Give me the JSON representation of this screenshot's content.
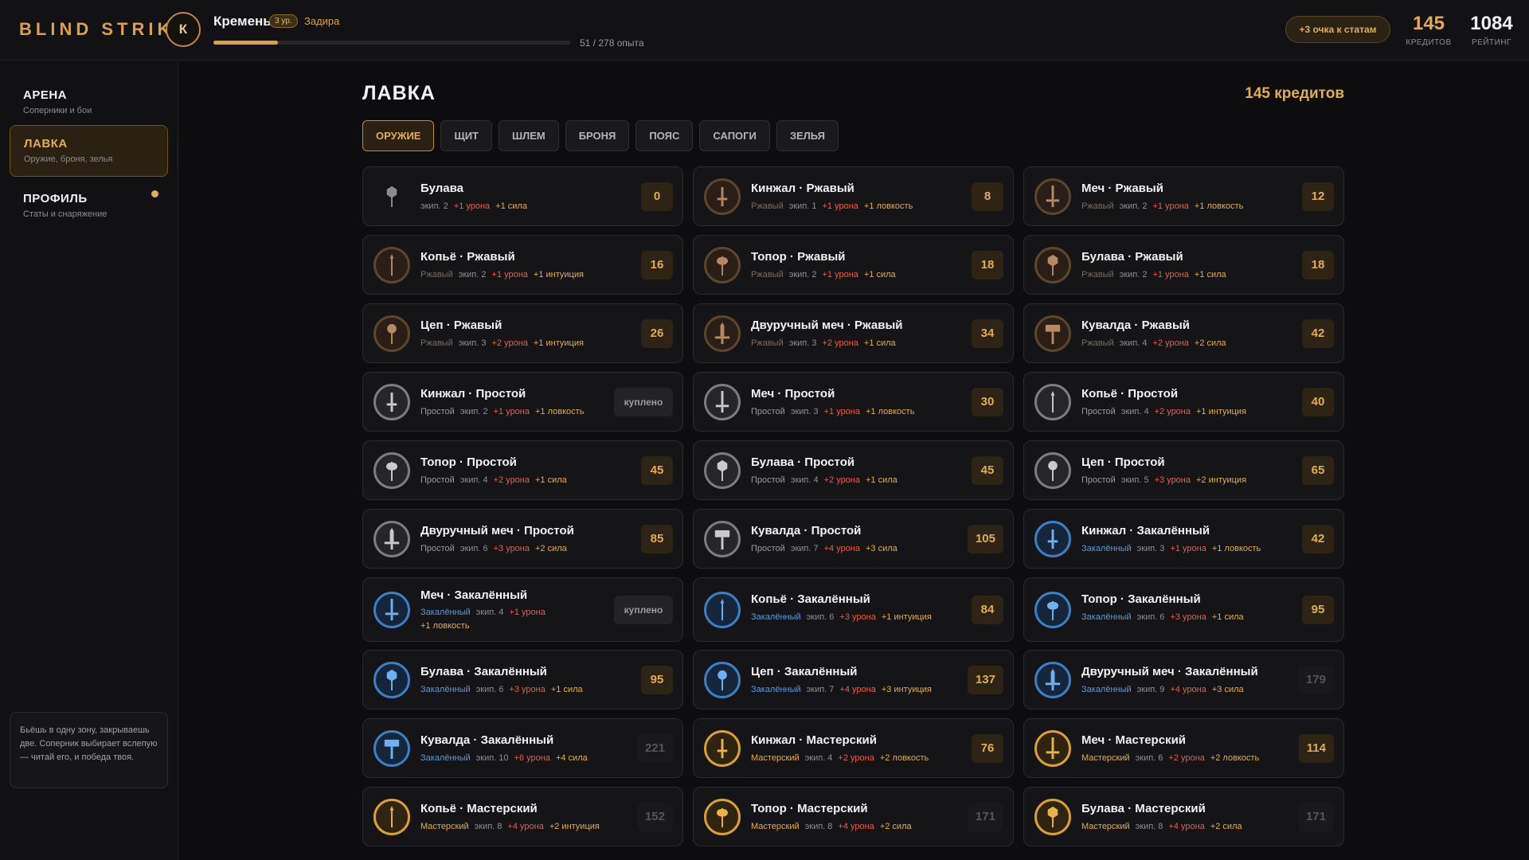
{
  "app": {
    "logo": "BLIND STRIKE",
    "user": {
      "initial": "К",
      "name": "Кремень",
      "level": "3 ур.",
      "class": "Задира",
      "xp_text": "51 / 278 опыта",
      "xp_progress": 0.18
    },
    "stat_points_button": "+3 очка к статам",
    "credits": {
      "value": "145",
      "label": "КРЕДИТОВ"
    },
    "rating": {
      "value": "1084",
      "label": "РЕЙТИНГ"
    }
  },
  "sidebar": {
    "items": [
      {
        "title": "АРЕНА",
        "sub": "Соперники и бои"
      },
      {
        "title": "ЛАВКА",
        "sub": "Оружие, броня, зелья"
      },
      {
        "title": "ПРОФИЛЬ",
        "sub": "Статы и снаряжение"
      }
    ],
    "tip": "Бьёшь в одну зону, закрываешь две. Соперник выбирает вслепую — читай его, и победа твоя."
  },
  "shop": {
    "title": "ЛАВКА",
    "credits": "145 кредитов",
    "tabs": [
      "ОРУЖИЕ",
      "ЩИТ",
      "ШЛЕМ",
      "БРОНЯ",
      "ПОЯС",
      "САПОГИ",
      "ЗЕЛЬЯ"
    ],
    "active_tab": 0,
    "items": [
      {
        "name": "Булава",
        "tier": "",
        "tier_class": "none",
        "icon": "mace-icon",
        "req": "экип. 2",
        "stat1": "+1 урона",
        "stat2": "+1 сила",
        "price": "0",
        "state": "buy"
      },
      {
        "name": "Кинжал · Ржавый",
        "tier": "Ржавый",
        "tier_class": "rust",
        "icon": "dagger-icon",
        "req": "экип. 1",
        "stat1": "+1 урона",
        "stat2": "+1 ловкость",
        "price": "8",
        "state": "buy"
      },
      {
        "name": "Меч · Ржавый",
        "tier": "Ржавый",
        "tier_class": "rust",
        "icon": "sword-icon",
        "req": "экип. 2",
        "stat1": "+1 урона",
        "stat2": "+1 ловкость",
        "price": "12",
        "state": "buy"
      },
      {
        "name": "Копьё · Ржавый",
        "tier": "Ржавый",
        "tier_class": "rust",
        "icon": "spear-icon",
        "req": "экип. 2",
        "stat1": "+1 урона",
        "stat2": "+1 интуиция",
        "price": "16",
        "state": "buy"
      },
      {
        "name": "Топор · Ржавый",
        "tier": "Ржавый",
        "tier_class": "rust",
        "icon": "axe-icon",
        "req": "экип. 2",
        "stat1": "+1 урона",
        "stat2": "+1 сила",
        "price": "18",
        "state": "buy"
      },
      {
        "name": "Булава · Ржавый",
        "tier": "Ржавый",
        "tier_class": "rust",
        "icon": "mace-icon",
        "req": "экип. 2",
        "stat1": "+1 урона",
        "stat2": "+1 сила",
        "price": "18",
        "state": "buy"
      },
      {
        "name": "Цеп · Ржавый",
        "tier": "Ржавый",
        "tier_class": "rust",
        "icon": "flail-icon",
        "req": "экип. 3",
        "stat1": "+2 урона",
        "stat2": "+1 интуиция",
        "price": "26",
        "state": "buy"
      },
      {
        "name": "Двуручный меч · Ржавый",
        "tier": "Ржавый",
        "tier_class": "rust",
        "icon": "greatsword-icon",
        "req": "экип. 3",
        "stat1": "+2 урона",
        "stat2": "+1 сила",
        "price": "34",
        "state": "buy"
      },
      {
        "name": "Кувалда · Ржавый",
        "tier": "Ржавый",
        "tier_class": "rust",
        "icon": "hammer-icon",
        "req": "экип. 4",
        "stat1": "+2 урона",
        "stat2": "+2 сила",
        "price": "42",
        "state": "buy"
      },
      {
        "name": "Кинжал · Простой",
        "tier": "Простой",
        "tier_class": "simple",
        "icon": "dagger-icon",
        "req": "экип. 2",
        "stat1": "+1 урона",
        "stat2": "+1 ловкость",
        "price": "куплено",
        "state": "owned"
      },
      {
        "name": "Меч · Простой",
        "tier": "Простой",
        "tier_class": "simple",
        "icon": "sword-icon",
        "req": "экип. 3",
        "stat1": "+1 урона",
        "stat2": "+1 ловкость",
        "price": "30",
        "state": "buy"
      },
      {
        "name": "Копьё · Простой",
        "tier": "Простой",
        "tier_class": "simple",
        "icon": "spear-icon",
        "req": "экип. 4",
        "stat1": "+2 урона",
        "stat2": "+1 интуиция",
        "price": "40",
        "state": "buy"
      },
      {
        "name": "Топор · Простой",
        "tier": "Простой",
        "tier_class": "simple",
        "icon": "axe-icon",
        "req": "экип. 4",
        "stat1": "+2 урона",
        "stat2": "+1 сила",
        "price": "45",
        "state": "buy"
      },
      {
        "name": "Булава · Простой",
        "tier": "Простой",
        "tier_class": "simple",
        "icon": "mace-icon",
        "req": "экип. 4",
        "stat1": "+2 урона",
        "stat2": "+1 сила",
        "price": "45",
        "state": "buy"
      },
      {
        "name": "Цеп · Простой",
        "tier": "Простой",
        "tier_class": "simple",
        "icon": "flail-icon",
        "req": "экип. 5",
        "stat1": "+3 урона",
        "stat2": "+2 интуиция",
        "price": "65",
        "state": "buy"
      },
      {
        "name": "Двуручный меч · Простой",
        "tier": "Простой",
        "tier_class": "simple",
        "icon": "greatsword-icon",
        "req": "экип. 6",
        "stat1": "+3 урона",
        "stat2": "+2 сила",
        "price": "85",
        "state": "buy"
      },
      {
        "name": "Кувалда · Простой",
        "tier": "Простой",
        "tier_class": "simple",
        "icon": "hammer-icon",
        "req": "экип. 7",
        "stat1": "+4 урона",
        "stat2": "+3 сила",
        "price": "105",
        "state": "buy"
      },
      {
        "name": "Кинжал · Закалённый",
        "tier": "Закалённый",
        "tier_class": "temp",
        "icon": "dagger-icon",
        "req": "экип. 3",
        "stat1": "+1 урона",
        "stat2": "+1 ловкость",
        "price": "42",
        "state": "buy"
      },
      {
        "name": "Меч · Закалённый",
        "tier": "Закалённый",
        "tier_class": "temp",
        "icon": "sword-icon",
        "req": "экип. 4",
        "stat1": "+1 урона",
        "stat2": "+1 ловкость",
        "price": "куплено",
        "state": "owned"
      },
      {
        "name": "Копьё · Закалённый",
        "tier": "Закалённый",
        "tier_class": "temp",
        "icon": "spear-icon",
        "req": "экип. 6",
        "stat1": "+3 урона",
        "stat2": "+1 интуиция",
        "price": "84",
        "state": "buy"
      },
      {
        "name": "Топор · Закалённый",
        "tier": "Закалённый",
        "tier_class": "temp",
        "icon": "axe-icon",
        "req": "экип. 6",
        "stat1": "+3 урона",
        "stat2": "+1 сила",
        "price": "95",
        "state": "buy"
      },
      {
        "name": "Булава · Закалённый",
        "tier": "Закалённый",
        "tier_class": "temp",
        "icon": "mace-icon",
        "req": "экип. 6",
        "stat1": "+3 урона",
        "stat2": "+1 сила",
        "price": "95",
        "state": "buy"
      },
      {
        "name": "Цеп · Закалённый",
        "tier": "Закалённый",
        "tier_class": "temp",
        "icon": "flail-icon",
        "req": "экип. 7",
        "stat1": "+4 урона",
        "stat2": "+3 интуиция",
        "price": "137",
        "state": "buy"
      },
      {
        "name": "Двуручный меч · Закалённый",
        "tier": "Закалённый",
        "tier_class": "temp",
        "icon": "greatsword-icon",
        "req": "экип. 9",
        "stat1": "+4 урона",
        "stat2": "+3 сила",
        "price": "179",
        "state": "unaffordable"
      },
      {
        "name": "Кувалда · Закалённый",
        "tier": "Закалённый",
        "tier_class": "temp",
        "icon": "hammer-icon",
        "req": "экип. 10",
        "stat1": "+6 урона",
        "stat2": "+4 сила",
        "price": "221",
        "state": "unaffordable"
      },
      {
        "name": "Кинжал · Мастерский",
        "tier": "Мастерский",
        "tier_class": "master",
        "icon": "dagger-icon",
        "req": "экип. 4",
        "stat1": "+2 урона",
        "stat2": "+2 ловкость",
        "price": "76",
        "state": "buy"
      },
      {
        "name": "Меч · Мастерский",
        "tier": "Мастерский",
        "tier_class": "master",
        "icon": "sword-icon",
        "req": "экип. 6",
        "stat1": "+2 урона",
        "stat2": "+2 ловкость",
        "price": "114",
        "state": "buy"
      },
      {
        "name": "Копьё · Мастерский",
        "tier": "Мастерский",
        "tier_class": "master",
        "icon": "spear-icon",
        "req": "экип. 8",
        "stat1": "+4 урона",
        "stat2": "+2 интуиция",
        "price": "152",
        "state": "unaffordable"
      },
      {
        "name": "Топор · Мастерский",
        "tier": "Мастерский",
        "tier_class": "master",
        "icon": "axe-icon",
        "req": "экип. 8",
        "stat1": "+4 урона",
        "stat2": "+2 сила",
        "price": "171",
        "state": "unaffordable"
      },
      {
        "name": "Булава · Мастерский",
        "tier": "Мастерский",
        "tier_class": "master",
        "icon": "mace-icon",
        "req": "экип. 8",
        "stat1": "+4 урона",
        "stat2": "+2 сила",
        "price": "171",
        "state": "unaffordable"
      }
    ]
  }
}
